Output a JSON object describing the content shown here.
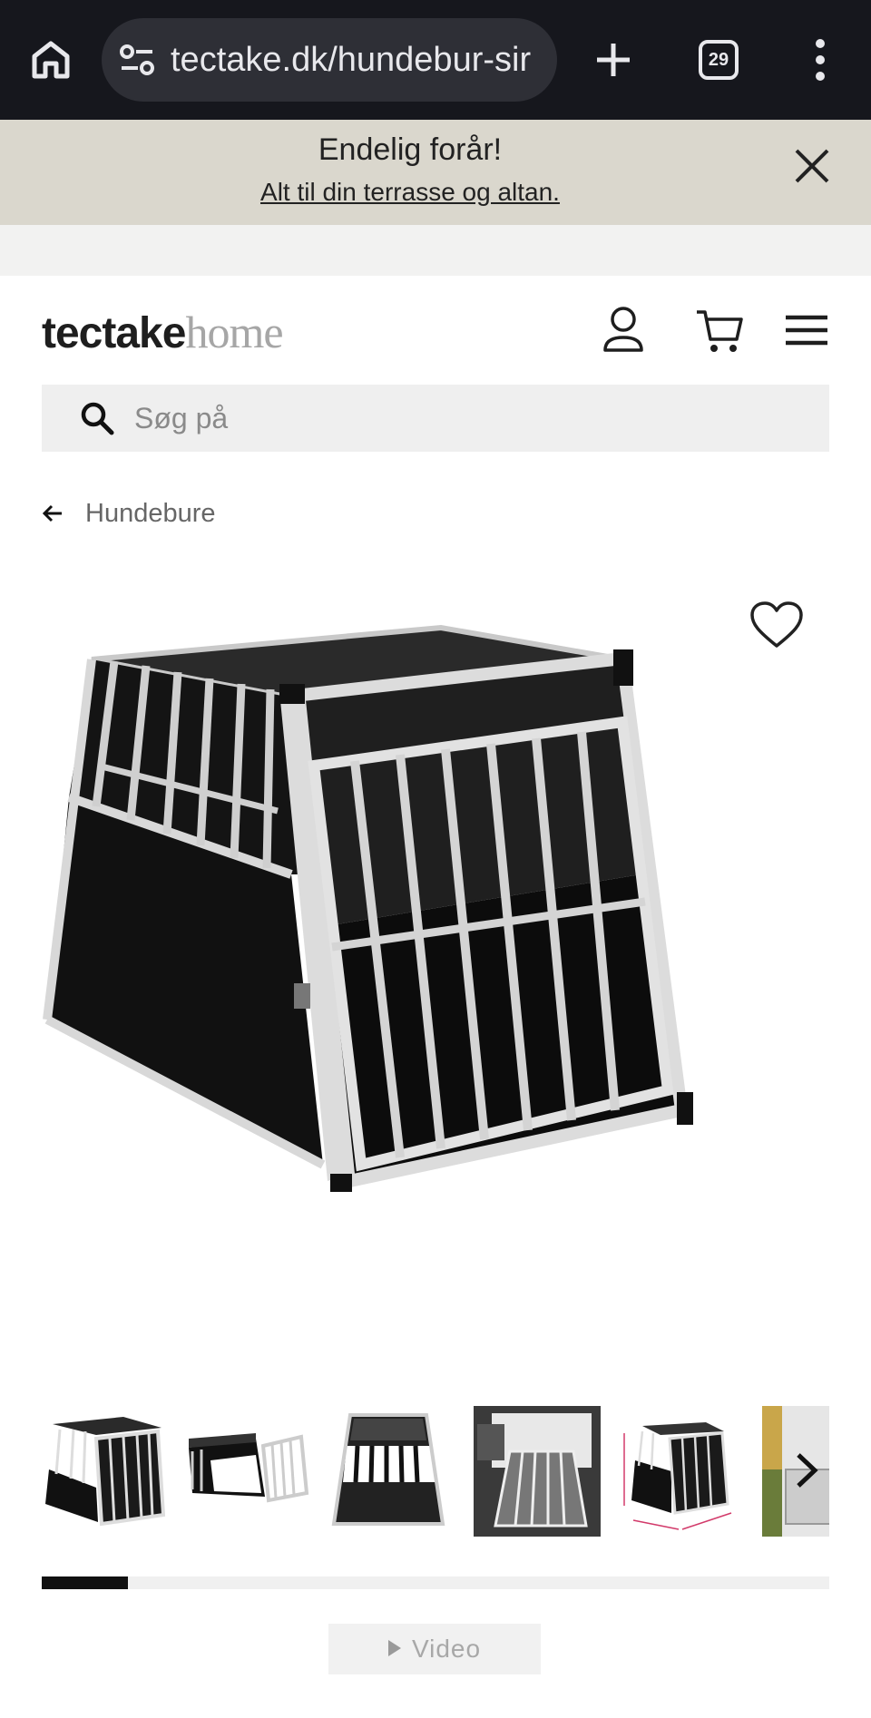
{
  "browser": {
    "url": "tectake.dk/hundebur-sir",
    "tab_count": "29",
    "icons": [
      "home-icon",
      "site-settings-icon",
      "new-tab-icon",
      "tab-switcher-icon",
      "more-options-icon"
    ]
  },
  "promo": {
    "title": "Endelig forår!",
    "link": "Alt til din terrasse og altan."
  },
  "header": {
    "logo_bold": "tectake",
    "logo_light": "home",
    "icons": [
      "user-icon",
      "cart-icon",
      "menu-icon"
    ]
  },
  "search": {
    "placeholder": "Søg på"
  },
  "breadcrumb": {
    "label": "Hundebure"
  },
  "gallery": {
    "thumbnail_count": 6,
    "progress_fraction": 0.11
  },
  "video": {
    "label": "Video"
  },
  "colors": {
    "chrome_bg": "#16171d",
    "promo_bg": "#dad7cd",
    "accent": "#111111"
  }
}
